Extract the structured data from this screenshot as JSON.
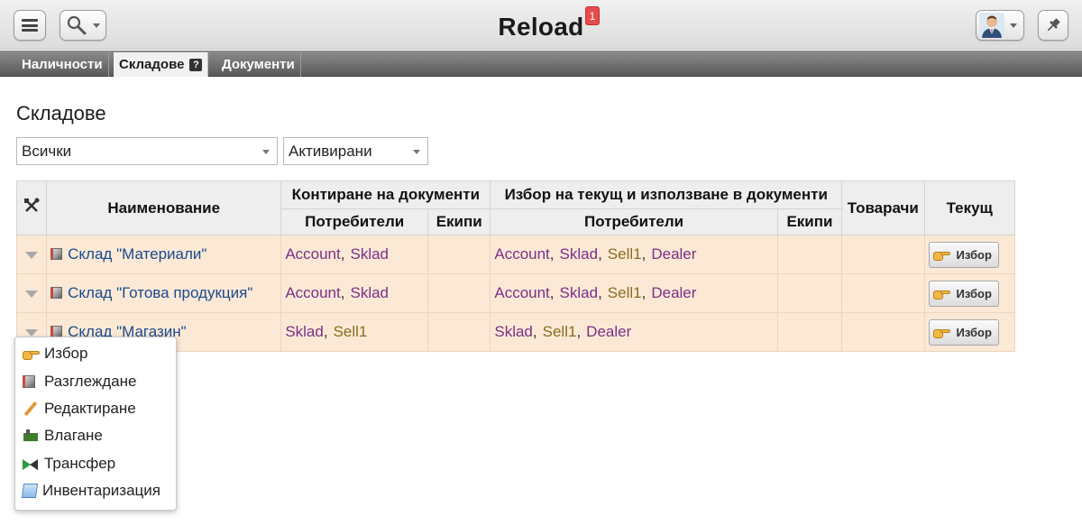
{
  "header": {
    "title": "Reload",
    "notification_count": "1",
    "icons": {
      "menu": "hamburger-menu-icon",
      "search": "magnifier-icon",
      "avatar": "user-avatar",
      "pin": "pushpin-icon"
    }
  },
  "tabs": [
    {
      "label": "Наличности",
      "active": false
    },
    {
      "label": "Складове",
      "active": true,
      "help": "?"
    },
    {
      "label": "Документи",
      "active": false
    }
  ],
  "page": {
    "title": "Складове",
    "filters": {
      "scope": "Всички",
      "state": "Активирани"
    }
  },
  "table": {
    "headers": {
      "tools_icon": "tools-icon",
      "name": "Наименование",
      "booking_group": "Контиране на документи",
      "booking_users": "Потребители",
      "booking_teams": "Екипи",
      "select_group": "Избор на текущ и използване в документи",
      "select_users": "Потребители",
      "select_teams": "Екипи",
      "storekeepers": "Товарачи",
      "current": "Текущ"
    },
    "rows": [
      {
        "name": "Склад \"Материали\"",
        "booking_users": [
          "Account",
          "Sklad"
        ],
        "select_users": [
          "Account",
          "Sklad",
          "Sell1",
          "Dealer"
        ],
        "action": "Избор"
      },
      {
        "name": "Склад \"Готова продукция\"",
        "booking_users": [
          "Account",
          "Sklad"
        ],
        "select_users": [
          "Account",
          "Sklad",
          "Sell1",
          "Dealer"
        ],
        "action": "Избор"
      },
      {
        "name": "Склад \"Магазин\"",
        "booking_users": [
          "Sklad",
          "Sell1"
        ],
        "select_users": [
          "Sklad",
          "Sell1",
          "Dealer"
        ],
        "action": "Избор"
      }
    ]
  },
  "context_menu": {
    "items": [
      {
        "label": "Избор",
        "icon": "pointing-hand-icon"
      },
      {
        "label": "Разглеждане",
        "icon": "view-icon"
      },
      {
        "label": "Редактиране",
        "icon": "pencil-icon"
      },
      {
        "label": "Влагане",
        "icon": "deposit-icon"
      },
      {
        "label": "Трансфер",
        "icon": "transfer-icon"
      },
      {
        "label": "Инвентаризация",
        "icon": "inventory-icon"
      }
    ]
  },
  "colors": {
    "row_bg": "#fbe9d6",
    "link_blue": "#1b4a8f",
    "link_purple": "#7b2f86",
    "link_olive": "#8a6b1e",
    "badge_red": "#e74b4b"
  }
}
